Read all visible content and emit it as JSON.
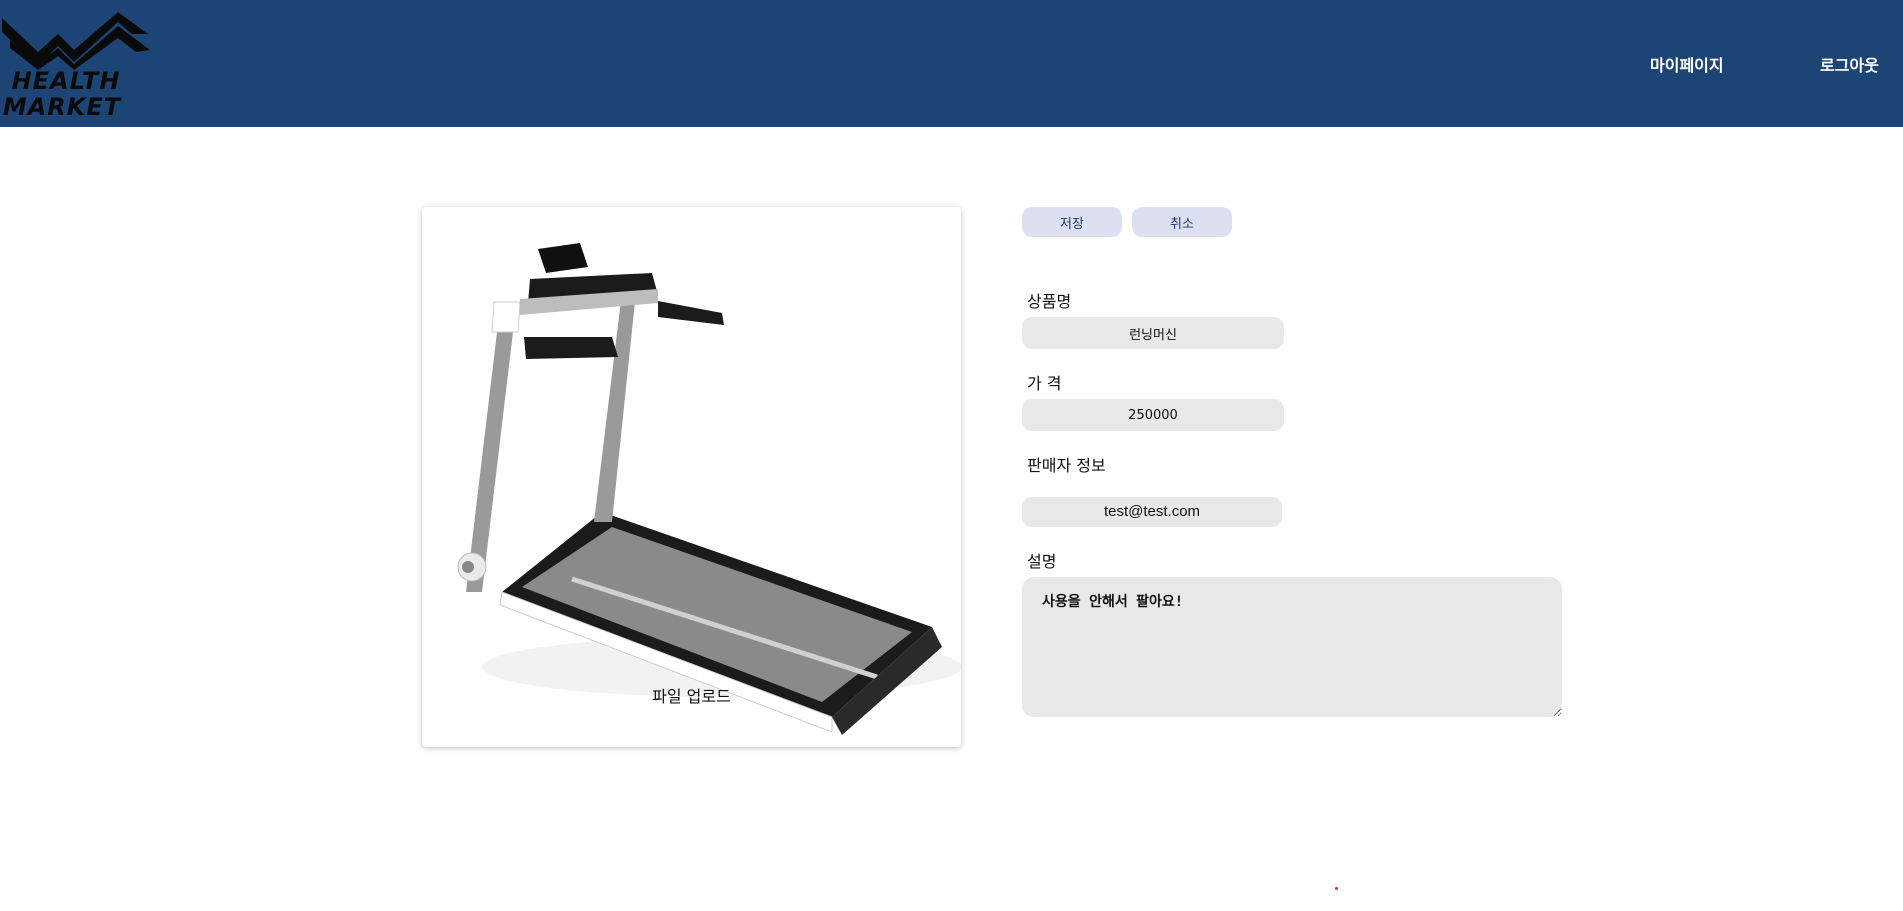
{
  "brand": {
    "line1": "HEALTH",
    "line2": "MARKET"
  },
  "nav": {
    "mypage": "마이페이지",
    "logout": "로그아웃"
  },
  "image": {
    "upload_label": "파일 업로드"
  },
  "actions": {
    "save": "저장",
    "cancel": "취소"
  },
  "form": {
    "name_label": "상품명",
    "name_value": "런닝머신",
    "price_label": "가 격",
    "price_value": "250000",
    "seller_label": "판매자 정보",
    "seller_value": "test@test.com",
    "desc_label": "설명",
    "desc_value": "사용을 안해서 팔아요!"
  },
  "colors": {
    "header": "#1c4576",
    "button": "#dde0f0",
    "field": "#e8e8e8"
  }
}
